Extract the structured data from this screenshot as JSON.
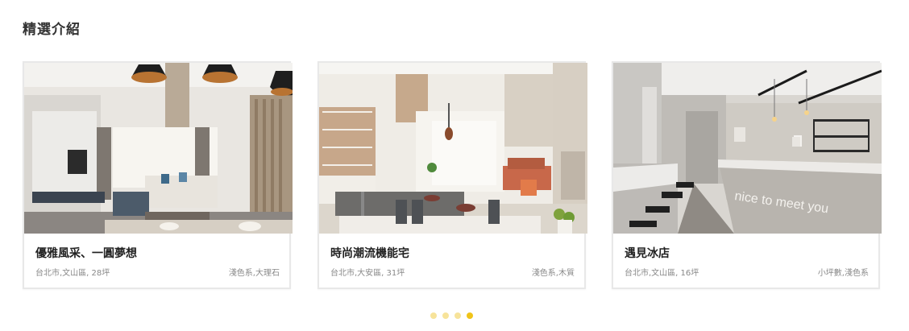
{
  "section": {
    "title": "精選介紹"
  },
  "cards": [
    {
      "title": "優雅風采、一圓夢想",
      "location": "台北市,文山區, 28坪",
      "tags": "淺色系,大理石"
    },
    {
      "title": "時尚潮流機能宅",
      "location": "台北市,大安區, 31坪",
      "tags": "淺色系,木質"
    },
    {
      "title": "遇見冰店",
      "location": "台北市,文山區, 16坪",
      "tags": "小坪數,淺色系",
      "wall_text": "nice to meet you"
    }
  ],
  "pagination": {
    "count": 4,
    "active_index": 3
  },
  "colors": {
    "dot_active": "#f0c419",
    "dot_inactive": "#f7e39a",
    "card_border": "#e8e8e8"
  }
}
